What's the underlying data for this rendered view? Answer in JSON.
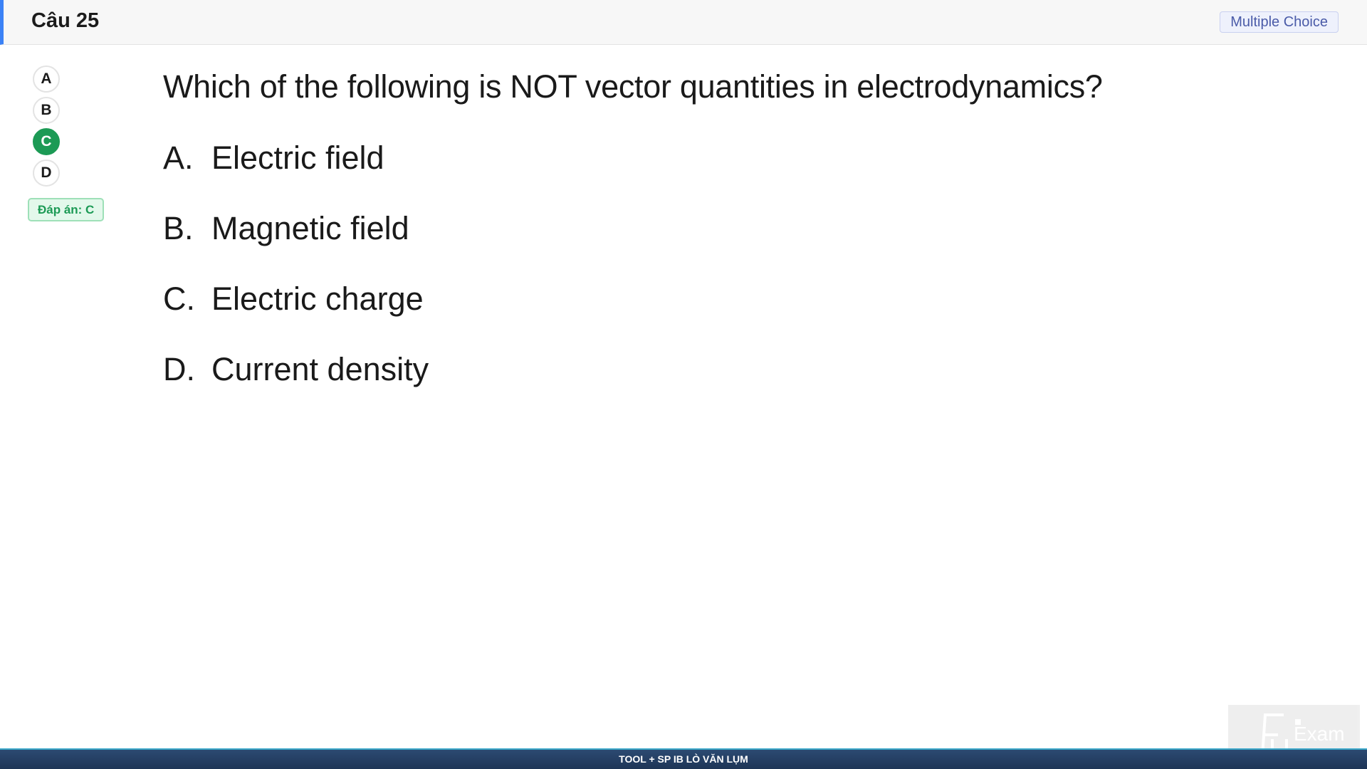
{
  "header": {
    "title": "Câu 25",
    "question_type": "Multiple Choice"
  },
  "choices": [
    {
      "letter": "A",
      "selected": false
    },
    {
      "letter": "B",
      "selected": false
    },
    {
      "letter": "C",
      "selected": true
    },
    {
      "letter": "D",
      "selected": false
    }
  ],
  "answer_badge": "Đáp án: C",
  "question": {
    "text": "Which of the following is NOT vector quantities in electrodynamics?",
    "options": [
      {
        "letter": "A.",
        "text": "Electric field"
      },
      {
        "letter": "B.",
        "text": "Magnetic field"
      },
      {
        "letter": "C.",
        "text": "Electric charge"
      },
      {
        "letter": "D.",
        "text": "Current density"
      }
    ]
  },
  "watermark": {
    "text": "Exam",
    "icon": "fu-exam-logo"
  },
  "footer": {
    "text": "TOOL + SP IB LÒ VĂN LỤM"
  },
  "colors": {
    "accent": "#3b82f6",
    "selected": "#1c9a55",
    "footer_bg": "#1e3556"
  }
}
